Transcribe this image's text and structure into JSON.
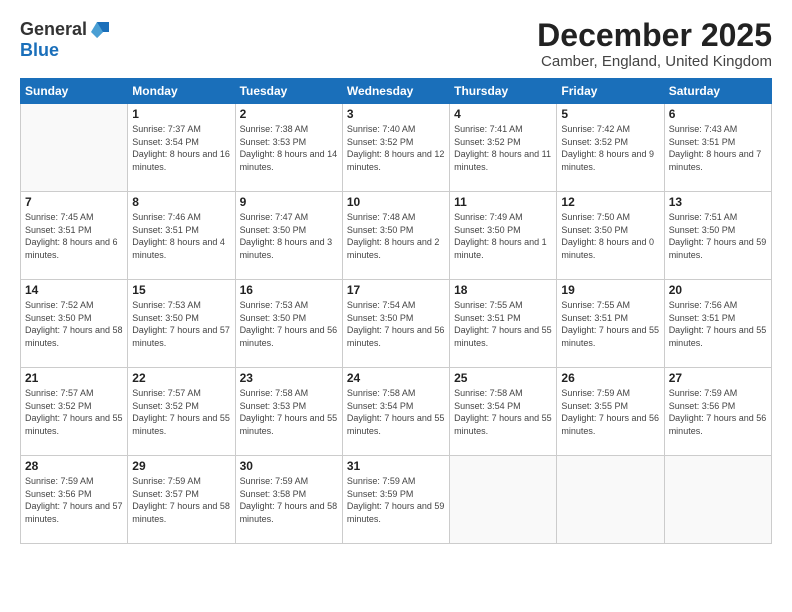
{
  "logo": {
    "general": "General",
    "blue": "Blue"
  },
  "title": "December 2025",
  "location": "Camber, England, United Kingdom",
  "weekdays": [
    "Sunday",
    "Monday",
    "Tuesday",
    "Wednesday",
    "Thursday",
    "Friday",
    "Saturday"
  ],
  "weeks": [
    [
      {
        "day": null,
        "sunrise": null,
        "sunset": null,
        "daylight": null
      },
      {
        "day": "1",
        "sunrise": "Sunrise: 7:37 AM",
        "sunset": "Sunset: 3:54 PM",
        "daylight": "Daylight: 8 hours and 16 minutes."
      },
      {
        "day": "2",
        "sunrise": "Sunrise: 7:38 AM",
        "sunset": "Sunset: 3:53 PM",
        "daylight": "Daylight: 8 hours and 14 minutes."
      },
      {
        "day": "3",
        "sunrise": "Sunrise: 7:40 AM",
        "sunset": "Sunset: 3:52 PM",
        "daylight": "Daylight: 8 hours and 12 minutes."
      },
      {
        "day": "4",
        "sunrise": "Sunrise: 7:41 AM",
        "sunset": "Sunset: 3:52 PM",
        "daylight": "Daylight: 8 hours and 11 minutes."
      },
      {
        "day": "5",
        "sunrise": "Sunrise: 7:42 AM",
        "sunset": "Sunset: 3:52 PM",
        "daylight": "Daylight: 8 hours and 9 minutes."
      },
      {
        "day": "6",
        "sunrise": "Sunrise: 7:43 AM",
        "sunset": "Sunset: 3:51 PM",
        "daylight": "Daylight: 8 hours and 7 minutes."
      }
    ],
    [
      {
        "day": "7",
        "sunrise": "Sunrise: 7:45 AM",
        "sunset": "Sunset: 3:51 PM",
        "daylight": "Daylight: 8 hours and 6 minutes."
      },
      {
        "day": "8",
        "sunrise": "Sunrise: 7:46 AM",
        "sunset": "Sunset: 3:51 PM",
        "daylight": "Daylight: 8 hours and 4 minutes."
      },
      {
        "day": "9",
        "sunrise": "Sunrise: 7:47 AM",
        "sunset": "Sunset: 3:50 PM",
        "daylight": "Daylight: 8 hours and 3 minutes."
      },
      {
        "day": "10",
        "sunrise": "Sunrise: 7:48 AM",
        "sunset": "Sunset: 3:50 PM",
        "daylight": "Daylight: 8 hours and 2 minutes."
      },
      {
        "day": "11",
        "sunrise": "Sunrise: 7:49 AM",
        "sunset": "Sunset: 3:50 PM",
        "daylight": "Daylight: 8 hours and 1 minute."
      },
      {
        "day": "12",
        "sunrise": "Sunrise: 7:50 AM",
        "sunset": "Sunset: 3:50 PM",
        "daylight": "Daylight: 8 hours and 0 minutes."
      },
      {
        "day": "13",
        "sunrise": "Sunrise: 7:51 AM",
        "sunset": "Sunset: 3:50 PM",
        "daylight": "Daylight: 7 hours and 59 minutes."
      }
    ],
    [
      {
        "day": "14",
        "sunrise": "Sunrise: 7:52 AM",
        "sunset": "Sunset: 3:50 PM",
        "daylight": "Daylight: 7 hours and 58 minutes."
      },
      {
        "day": "15",
        "sunrise": "Sunrise: 7:53 AM",
        "sunset": "Sunset: 3:50 PM",
        "daylight": "Daylight: 7 hours and 57 minutes."
      },
      {
        "day": "16",
        "sunrise": "Sunrise: 7:53 AM",
        "sunset": "Sunset: 3:50 PM",
        "daylight": "Daylight: 7 hours and 56 minutes."
      },
      {
        "day": "17",
        "sunrise": "Sunrise: 7:54 AM",
        "sunset": "Sunset: 3:50 PM",
        "daylight": "Daylight: 7 hours and 56 minutes."
      },
      {
        "day": "18",
        "sunrise": "Sunrise: 7:55 AM",
        "sunset": "Sunset: 3:51 PM",
        "daylight": "Daylight: 7 hours and 55 minutes."
      },
      {
        "day": "19",
        "sunrise": "Sunrise: 7:55 AM",
        "sunset": "Sunset: 3:51 PM",
        "daylight": "Daylight: 7 hours and 55 minutes."
      },
      {
        "day": "20",
        "sunrise": "Sunrise: 7:56 AM",
        "sunset": "Sunset: 3:51 PM",
        "daylight": "Daylight: 7 hours and 55 minutes."
      }
    ],
    [
      {
        "day": "21",
        "sunrise": "Sunrise: 7:57 AM",
        "sunset": "Sunset: 3:52 PM",
        "daylight": "Daylight: 7 hours and 55 minutes."
      },
      {
        "day": "22",
        "sunrise": "Sunrise: 7:57 AM",
        "sunset": "Sunset: 3:52 PM",
        "daylight": "Daylight: 7 hours and 55 minutes."
      },
      {
        "day": "23",
        "sunrise": "Sunrise: 7:58 AM",
        "sunset": "Sunset: 3:53 PM",
        "daylight": "Daylight: 7 hours and 55 minutes."
      },
      {
        "day": "24",
        "sunrise": "Sunrise: 7:58 AM",
        "sunset": "Sunset: 3:54 PM",
        "daylight": "Daylight: 7 hours and 55 minutes."
      },
      {
        "day": "25",
        "sunrise": "Sunrise: 7:58 AM",
        "sunset": "Sunset: 3:54 PM",
        "daylight": "Daylight: 7 hours and 55 minutes."
      },
      {
        "day": "26",
        "sunrise": "Sunrise: 7:59 AM",
        "sunset": "Sunset: 3:55 PM",
        "daylight": "Daylight: 7 hours and 56 minutes."
      },
      {
        "day": "27",
        "sunrise": "Sunrise: 7:59 AM",
        "sunset": "Sunset: 3:56 PM",
        "daylight": "Daylight: 7 hours and 56 minutes."
      }
    ],
    [
      {
        "day": "28",
        "sunrise": "Sunrise: 7:59 AM",
        "sunset": "Sunset: 3:56 PM",
        "daylight": "Daylight: 7 hours and 57 minutes."
      },
      {
        "day": "29",
        "sunrise": "Sunrise: 7:59 AM",
        "sunset": "Sunset: 3:57 PM",
        "daylight": "Daylight: 7 hours and 58 minutes."
      },
      {
        "day": "30",
        "sunrise": "Sunrise: 7:59 AM",
        "sunset": "Sunset: 3:58 PM",
        "daylight": "Daylight: 7 hours and 58 minutes."
      },
      {
        "day": "31",
        "sunrise": "Sunrise: 7:59 AM",
        "sunset": "Sunset: 3:59 PM",
        "daylight": "Daylight: 7 hours and 59 minutes."
      },
      {
        "day": null,
        "sunrise": null,
        "sunset": null,
        "daylight": null
      },
      {
        "day": null,
        "sunrise": null,
        "sunset": null,
        "daylight": null
      },
      {
        "day": null,
        "sunrise": null,
        "sunset": null,
        "daylight": null
      }
    ]
  ]
}
